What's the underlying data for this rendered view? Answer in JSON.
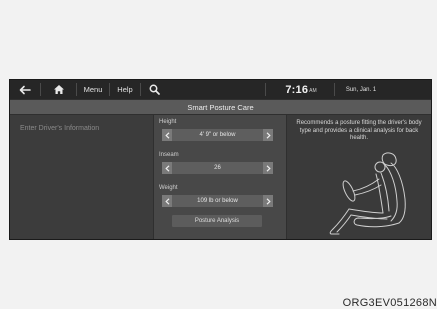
{
  "status_bar": {
    "back_icon": "back-arrow-icon",
    "home_icon": "home-icon",
    "menu_label": "Menu",
    "help_label": "Help",
    "search_icon": "search-icon",
    "time": "7:16",
    "ampm": "AM",
    "date": "Sun, Jan. 1"
  },
  "title": "Smart Posture Care",
  "left_panel": {
    "heading": "Enter Driver's Information"
  },
  "form": {
    "height": {
      "label": "Height",
      "value": "4' 9\" or below"
    },
    "inseam": {
      "label": "Inseam",
      "value": "26"
    },
    "weight": {
      "label": "Weight",
      "value": "109 lb or below"
    },
    "analysis_button": "Posture Analysis"
  },
  "right_panel": {
    "description": "Recommends a posture fitting the driver's body type and provides a clinical analysis for back health.",
    "illustration": "driver-seated-posture-illustration"
  },
  "photo_code": "ORG3EV051268N",
  "colors": {
    "screen_bg": "#2f2f2f",
    "title_bar": "#5a5a5a",
    "panel_mid": "#484848"
  }
}
